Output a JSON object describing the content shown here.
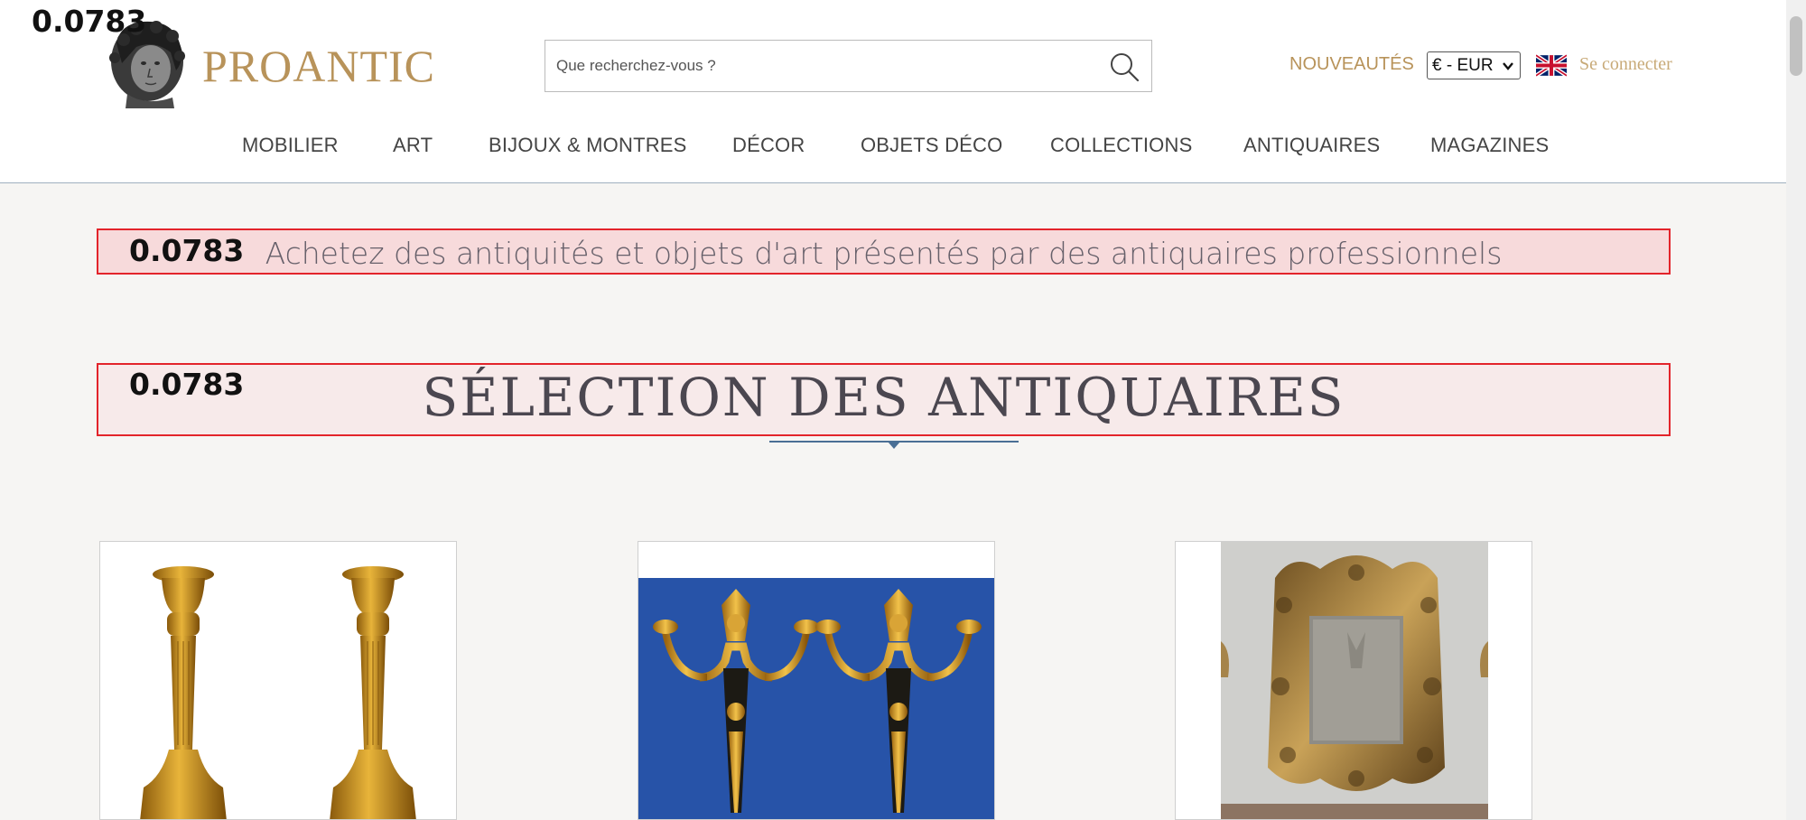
{
  "debug": {
    "score_label": "0.0783"
  },
  "header": {
    "brand": "PROANTIC",
    "search": {
      "placeholder": "Que recherchez-vous ?"
    },
    "nouveautes": "NOUVEAUTÉS",
    "currency": "€ - EUR",
    "login": "Se connecter",
    "icons": {
      "logo": "bust-logo-icon",
      "search": "search-icon",
      "flag": "uk-flag-icon",
      "currency_arrow": "chevron-down-icon"
    }
  },
  "nav": {
    "items": [
      "MOBILIER",
      "ART",
      "BIJOUX & MONTRES",
      "DÉCOR",
      "OBJETS DÉCO",
      "COLLECTIONS",
      "ANTIQUAIRES",
      "MAGAZINES"
    ]
  },
  "hero": {
    "tagline": "Achetez des antiquités et objets d'art présentés par des antiquaires professionnels",
    "section_title": "SÉLECTION DES ANTIQUAIRES"
  },
  "products": [
    {
      "image": "gilt-bronze-candlesticks-image"
    },
    {
      "image": "gilt-bronze-sconces-image"
    },
    {
      "image": "carved-giltwood-mirror-image"
    }
  ],
  "colors": {
    "brand_gold": "#b8935a",
    "banner_border": "#e3242b",
    "divider_blue": "#4a6f95",
    "page_bg": "#f6f5f3"
  }
}
